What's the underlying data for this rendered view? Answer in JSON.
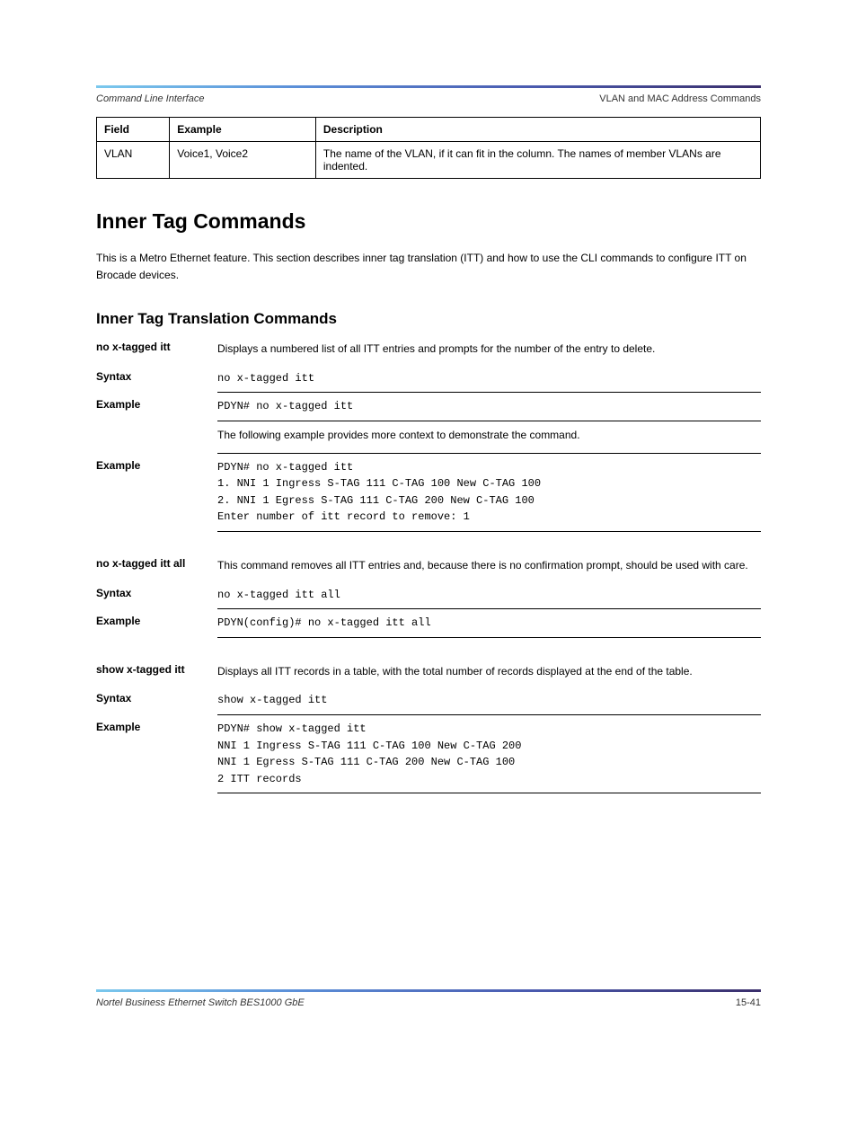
{
  "header": {
    "left": "Command Line Interface",
    "right": "VLAN and MAC Address Commands"
  },
  "table": {
    "headers": [
      "Field",
      "Example",
      "Description"
    ],
    "row": {
      "field": "VLAN",
      "example": "Voice1, Voice2",
      "description": "The name of the VLAN, if it can fit in the column. The names of member VLANs are indented."
    }
  },
  "section": {
    "h2": "Inner Tag Commands",
    "intro": "This is a Metro Ethernet feature. This section describes inner tag translation (ITT) and how to use the CLI commands to configure ITT on Brocade devices.",
    "h3": "Inner Tag Translation Commands"
  },
  "cmd1": {
    "title": "no x-tagged itt",
    "desc": "Displays a numbered list of all ITT entries and prompts for the number of the entry to delete.",
    "syntax": "no x-tagged itt",
    "example_label": "Example",
    "example1": "PDYN# no x-tagged itt",
    "example2_lines": [
      "PDYN# no x-tagged itt",
      "1. NNI 1 Ingress  S-TAG 111  C-TAG 100  New C-TAG 100",
      "2. NNI 1 Egress   S-TAG 111  C-TAG 200  New C-TAG 100",
      "Enter number of itt record to remove: 1"
    ]
  },
  "cmd2": {
    "title": "no x-tagged itt all",
    "desc": "This command removes all ITT entries and, because there is no confirmation prompt, should be used with care.",
    "syntax": "no x-tagged itt all",
    "example_label": "Example",
    "example": "PDYN(config)# no x-tagged itt all"
  },
  "cmd3": {
    "title": "show x-tagged itt",
    "desc": "Displays all ITT records in a table, with the total number of records displayed at the end of the table.",
    "syntax": "show x-tagged itt",
    "example_label": "Example",
    "example_lines": [
      "PDYN# show x-tagged itt",
      "NNI 1 Ingress  S-TAG 111  C-TAG 100  New C-TAG 200",
      "NNI 1 Egress   S-TAG 111  C-TAG 200  New C-TAG 100",
      "2 ITT records"
    ]
  },
  "footer": {
    "left": "Nortel Business Ethernet Switch BES1000 GbE",
    "right": "15-41"
  }
}
